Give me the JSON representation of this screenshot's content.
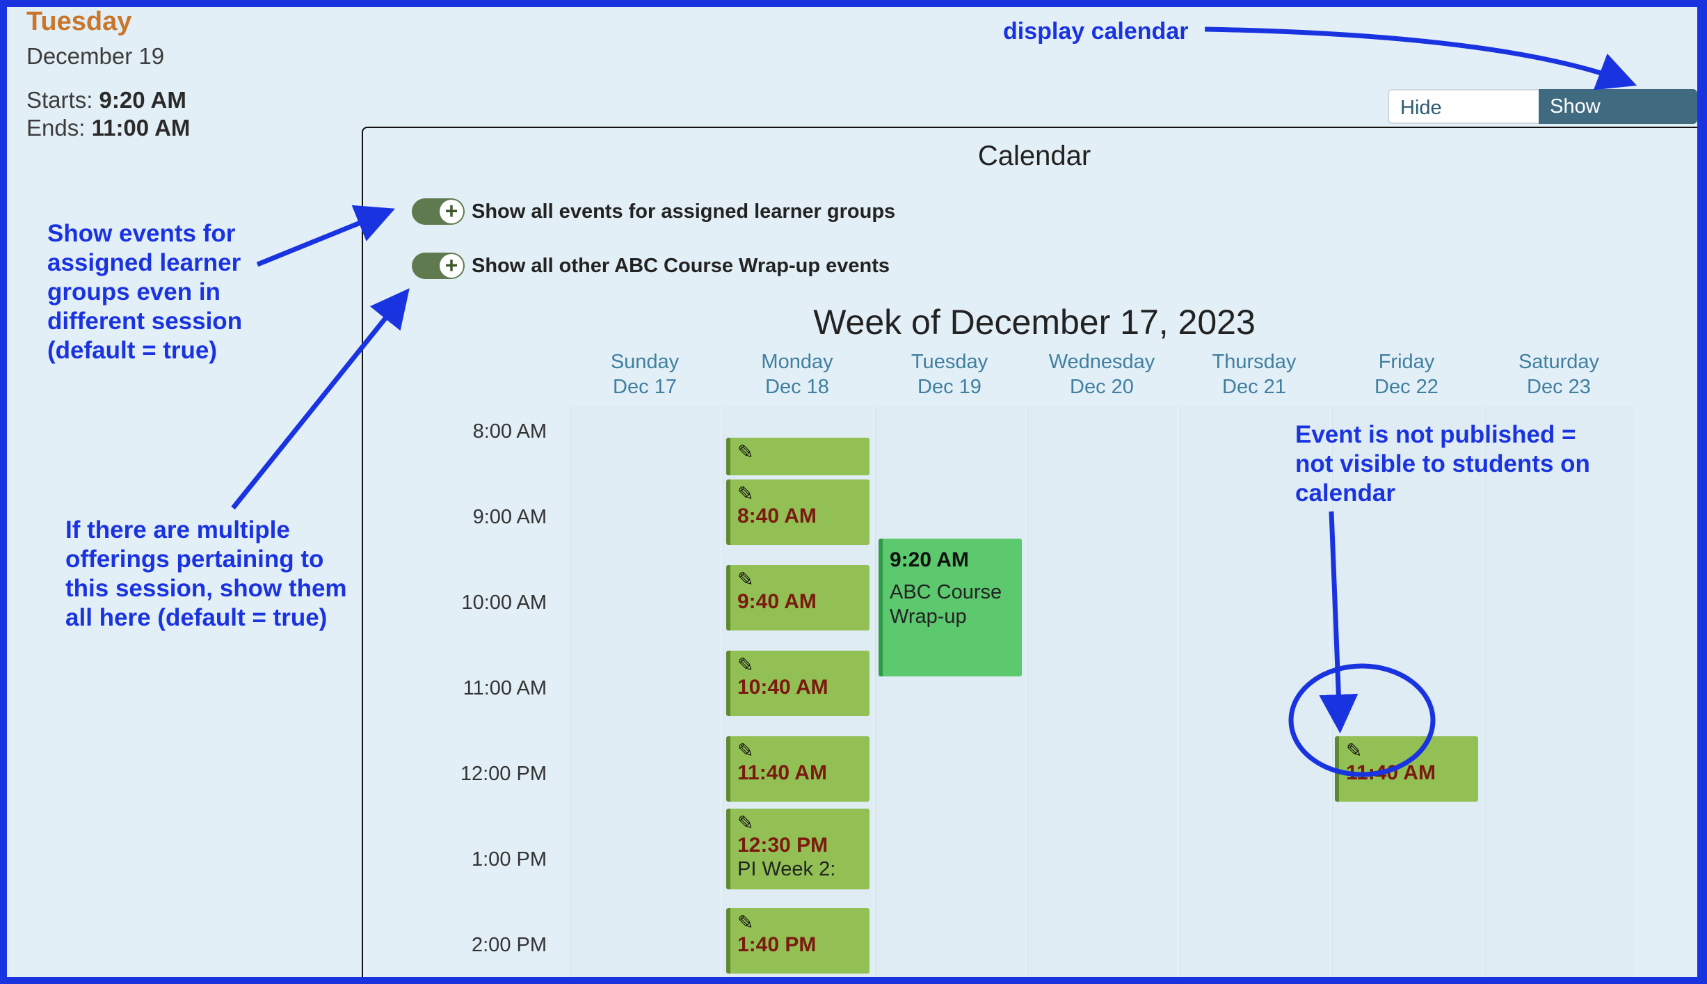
{
  "session": {
    "day": "Tuesday",
    "date": "December 19",
    "starts_label": "Starts:",
    "starts_value": "9:20 AM",
    "ends_label": "Ends:",
    "ends_value": "11:00 AM"
  },
  "buttons": {
    "hide": "Hide Calendar",
    "show": "Show Calendar"
  },
  "calendar": {
    "title": "Calendar",
    "toggle1": "Show all events for assigned learner groups",
    "toggle2": "Show all other ABC Course Wrap-up events",
    "week_title": "Week of December 17, 2023",
    "days": [
      {
        "name": "Sunday",
        "date": "Dec 17"
      },
      {
        "name": "Monday",
        "date": "Dec 18"
      },
      {
        "name": "Tuesday",
        "date": "Dec 19"
      },
      {
        "name": "Wednesday",
        "date": "Dec 20"
      },
      {
        "name": "Thursday",
        "date": "Dec 21"
      },
      {
        "name": "Friday",
        "date": "Dec 22"
      },
      {
        "name": "Saturday",
        "date": "Dec 23"
      }
    ],
    "times": [
      "8:00 AM",
      "9:00 AM",
      "10:00 AM",
      "11:00 AM",
      "12:00 PM",
      "1:00 PM",
      "2:00 PM"
    ],
    "events": [
      {
        "time": "8:40 AM"
      },
      {
        "time": "9:40 AM"
      },
      {
        "time": "10:40 AM"
      },
      {
        "time": "11:40 AM"
      },
      {
        "time": "12:30 PM",
        "title": "PI Week 2:"
      },
      {
        "time": "1:40 PM"
      },
      {
        "time": "9:20 AM",
        "title": "ABC Course Wrap-up"
      },
      {
        "time": "11:40 AM"
      }
    ]
  },
  "annotations": {
    "display_calendar": "display calendar",
    "learner_groups": "Show events for assigned learner groups even in different session (default = true)",
    "offerings": "If there are multiple offerings pertaining to this session, show them all here (default = true)",
    "not_published": "Event is not published = not visible to students on calendar"
  },
  "colors": {
    "frame": "#1a33e0",
    "annotation": "#1a33e0",
    "event_unpublished": "#92c054",
    "event_published": "#5cc96e",
    "event_time": "#7a1a10",
    "day_header": "#3f7f9f",
    "show_button": "#3f6a80"
  },
  "icons": [
    "edit-icon",
    "plus-icon"
  ]
}
